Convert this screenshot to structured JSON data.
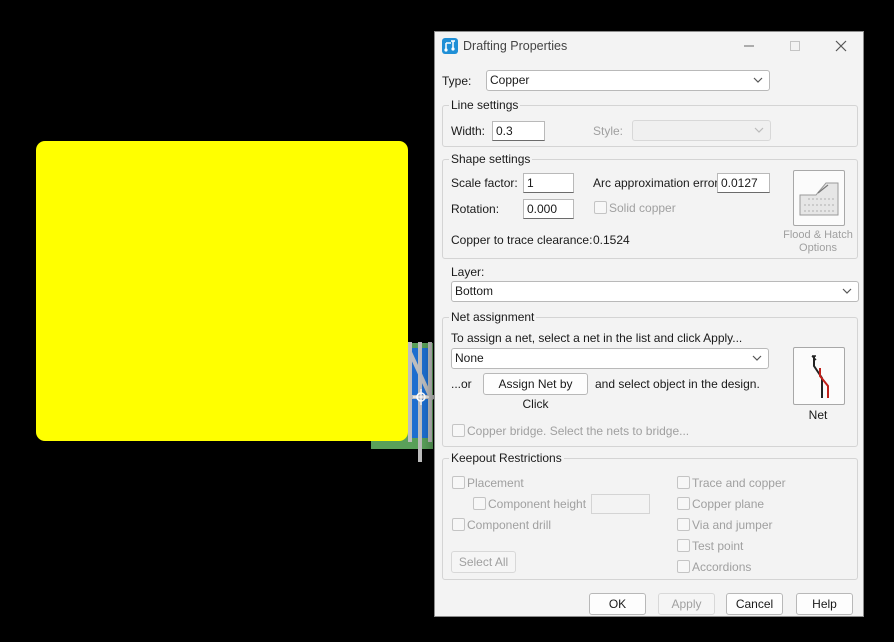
{
  "dialog": {
    "title": "Drafting Properties",
    "type_label": "Type:",
    "type_value": "Copper",
    "line_settings": {
      "title": "Line settings",
      "width_label": "Width:",
      "width_value": "0.3",
      "style_label": "Style:",
      "style_value": ""
    },
    "shape_settings": {
      "title": "Shape settings",
      "scale_label": "Scale factor:",
      "scale_value": "1",
      "arc_label": "Arc approximation error:",
      "arc_value": "0.0127",
      "rotation_label": "Rotation:",
      "rotation_value": "0.000",
      "solid_copper_label": "Solid copper",
      "clearance_label": "Copper to trace clearance:",
      "clearance_value": "0.1524",
      "flood_label_1": "Flood & Hatch",
      "flood_label_2": "Options"
    },
    "layer": {
      "label": "Layer:",
      "value": "Bottom"
    },
    "net_assignment": {
      "title": "Net assignment",
      "instruction": "To assign a net, select a net in the list and click Apply...",
      "net_value": "None",
      "or_label": "...or",
      "assign_button": "Assign Net by Click",
      "suffix": "and select object in the design.",
      "net_button_label": "Net",
      "copper_bridge_label": "Copper bridge. Select the nets to bridge..."
    },
    "keepout": {
      "title": "Keepout Restrictions",
      "placement": "Placement",
      "component_height": "Component height",
      "component_drill": "Component drill",
      "select_all": "Select All",
      "trace_copper": "Trace and copper",
      "copper_plane": "Copper plane",
      "via_jumper": "Via and jumper",
      "test_point": "Test point",
      "accordions": "Accordions"
    },
    "buttons": {
      "ok": "OK",
      "apply": "Apply",
      "cancel": "Cancel",
      "help": "Help"
    }
  },
  "colors": {
    "canvas_background": "#000000",
    "shape_fill": "#ffff00",
    "dialog_background": "#f3f3f3"
  },
  "icons": [
    "app-icon",
    "minimize-icon",
    "maximize-icon",
    "close-icon",
    "chevron-down-icon",
    "flood-hatch-icon",
    "net-icon",
    "cursor-crosshair-icon"
  ]
}
